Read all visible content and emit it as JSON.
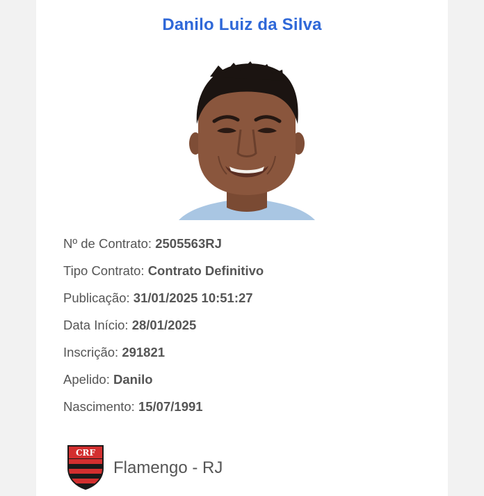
{
  "player": {
    "name": "Danilo Luiz da Silva"
  },
  "details": [
    {
      "label": "Nº de Contrato:",
      "value": "2505563RJ"
    },
    {
      "label": "Tipo Contrato:",
      "value": "Contrato Definitivo"
    },
    {
      "label": "Publicação:",
      "value": "31/01/2025 10:51:27"
    },
    {
      "label": "Data Início:",
      "value": "28/01/2025"
    },
    {
      "label": "Inscrição:",
      "value": "291821"
    },
    {
      "label": "Apelido:",
      "value": "Danilo"
    },
    {
      "label": "Nascimento:",
      "value": "15/07/1991"
    }
  ],
  "club": {
    "name": "Flamengo - RJ",
    "crest_icon": "flamengo-crest-icon",
    "crest_monogram": "CRF",
    "colors": {
      "red": "#d32f2f",
      "black": "#1a1a1a"
    }
  },
  "colors": {
    "name": "#2f68d8",
    "text": "#555555",
    "page_bg": "#f2f2f2",
    "card_bg": "#ffffff"
  }
}
